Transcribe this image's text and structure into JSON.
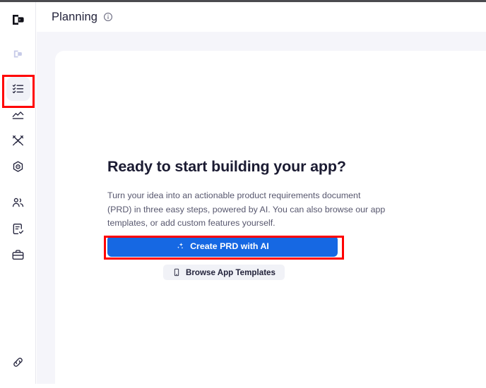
{
  "app": {
    "logo_icon": "app-logo-mark"
  },
  "header": {
    "title": "Planning",
    "info_icon": "info-circle-icon"
  },
  "sidebar": {
    "secondary_logo_icon": "app-logo-mark-muted",
    "items": [
      {
        "key": "planning",
        "icon": "checklist-icon",
        "label": "Planning",
        "active": true
      },
      {
        "key": "analytics",
        "icon": "area-chart-icon",
        "label": "Analytics",
        "active": false
      },
      {
        "key": "build",
        "icon": "tools-icon",
        "label": "Build",
        "active": false
      },
      {
        "key": "settings",
        "icon": "target-gear-icon",
        "label": "Settings",
        "active": false
      },
      {
        "key": "team",
        "icon": "users-icon",
        "label": "Team",
        "active": false
      },
      {
        "key": "tasks",
        "icon": "task-check-icon",
        "label": "Tasks",
        "active": false
      },
      {
        "key": "workspace",
        "icon": "briefcase-icon",
        "label": "Workspace",
        "active": false
      }
    ],
    "bottom_item": {
      "key": "link",
      "icon": "link-icon",
      "label": "Link"
    }
  },
  "main": {
    "title": "Ready to start building your app?",
    "description": "Turn your idea into an actionable product requirements document (PRD) in three easy steps, powered by AI. You can also browse our app templates, or add custom features yourself.",
    "primary_button": {
      "label": "Create PRD with AI",
      "icon": "sparkles-icon"
    },
    "secondary_button": {
      "label": "Browse App Templates",
      "icon": "mobile-device-icon"
    }
  },
  "annotations": {
    "highlight_color": "#ff0000",
    "boxes": [
      {
        "name": "sidebar-planning-highlight"
      },
      {
        "name": "create-prd-highlight"
      }
    ]
  },
  "colors": {
    "primary": "#1668e3",
    "page_background": "#f5f5fa",
    "card_background": "#ffffff",
    "text_primary": "#1b1b32",
    "text_secondary": "#57576e"
  }
}
